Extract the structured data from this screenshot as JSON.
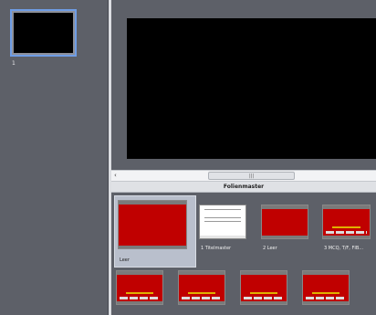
{
  "app": {
    "slide_list": {
      "selected_number": "1"
    },
    "scroll": {
      "left_arrow": "‹",
      "grip": "|||"
    },
    "panel": {
      "title": "Folienmaster",
      "layouts": [
        {
          "label": "Leer",
          "selected": true
        },
        {
          "label": "1 Titelmaster",
          "selected": false
        },
        {
          "label": "2 Leer",
          "selected": false
        },
        {
          "label": "3 MCQ, T/F, FIB...",
          "selected": false
        },
        {
          "label": "",
          "selected": false
        },
        {
          "label": "",
          "selected": false
        },
        {
          "label": "",
          "selected": false
        },
        {
          "label": "",
          "selected": false
        }
      ]
    },
    "colors": {
      "accent": "#6f9de6",
      "slide_red": "#c00000",
      "bg": "#5d6068"
    }
  }
}
